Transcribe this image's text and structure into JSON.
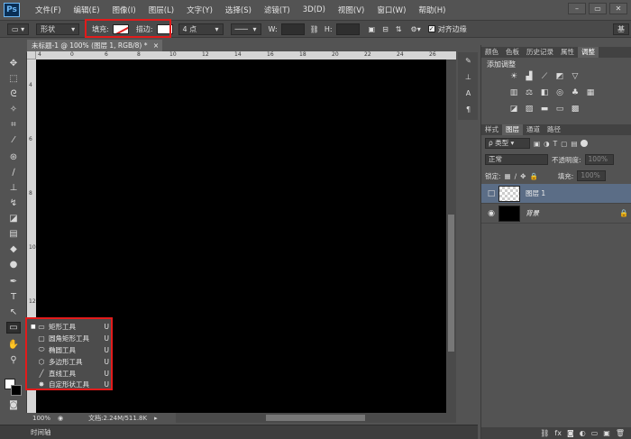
{
  "app": {
    "logo": "Ps"
  },
  "menu": [
    "文件(F)",
    "编辑(E)",
    "图像(I)",
    "图层(L)",
    "文字(Y)",
    "选择(S)",
    "滤镜(T)",
    "3D(D)",
    "视图(V)",
    "窗口(W)",
    "帮助(H)"
  ],
  "window_controls": {
    "minimize": "–",
    "restore": "▭",
    "close": "✕"
  },
  "options": {
    "mode": "形状",
    "fill_label": "填充:",
    "stroke_label": "描边:",
    "stroke_width": "4 点",
    "w_label": "W:",
    "h_label": "H:",
    "align_edges": "对齐边缘",
    "workspace": "基"
  },
  "document": {
    "tab_title": "未标题-1 @ 100% (图层 1, RGB/8) *",
    "zoom": "100%",
    "doc_info": "文档:2.24M/511.8K",
    "ruler_h": [
      "4",
      "0",
      "6",
      "8",
      "10",
      "12",
      "14",
      "16",
      "18",
      "20",
      "22",
      "24",
      "26"
    ],
    "ruler_v": [
      "4",
      "6",
      "8",
      "10",
      "12",
      "14"
    ]
  },
  "flyout": {
    "items": [
      {
        "icon": "▭",
        "label": "矩形工具",
        "key": "U",
        "active": true
      },
      {
        "icon": "▢",
        "label": "圆角矩形工具",
        "key": "U"
      },
      {
        "icon": "⬭",
        "label": "椭圆工具",
        "key": "U"
      },
      {
        "icon": "⬡",
        "label": "多边形工具",
        "key": "U"
      },
      {
        "icon": "╱",
        "label": "直线工具",
        "key": "U"
      },
      {
        "icon": "✸",
        "label": "自定形状工具",
        "key": "U"
      }
    ]
  },
  "panels": {
    "top_tabs": [
      "颜色",
      "色板",
      "历史记录",
      "属性",
      "调整"
    ],
    "adjust_title": "添加调整",
    "layer_tabs": [
      "样式",
      "图层",
      "通道",
      "路径"
    ],
    "kind_label": "ρ 类型",
    "blend_mode": "正常",
    "opacity_label": "不透明度:",
    "opacity_value": "100%",
    "lock_label": "锁定:",
    "fill_label": "填充:",
    "fill_value": "100%",
    "layers": [
      {
        "name": "图层 1",
        "visible": false,
        "selected": true
      },
      {
        "name": "背景",
        "visible": true,
        "locked": true
      }
    ]
  },
  "timeline_label": "时间轴"
}
